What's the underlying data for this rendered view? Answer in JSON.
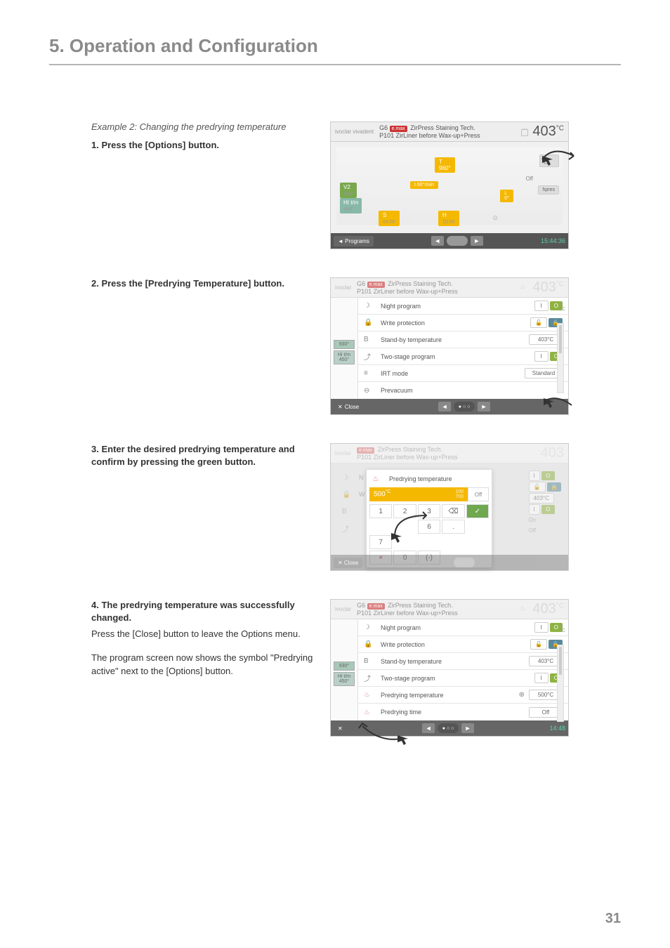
{
  "header": {
    "title": "5. Operation and Configuration"
  },
  "example_label": "Example 2: Changing the predrying temperature",
  "steps": {
    "s1": "1.  Press the [Options] button.",
    "s2": "2.  Press the [Predrying Temperature] button.",
    "s3": "3.  Enter the desired predrying temperature and confirm by pressing the green button.",
    "s4_title": "4.  The predrying temperature was successfully changed.",
    "s4_line1": "Press the [Close] button to leave the Options menu.",
    "s4_line2": "The program screen now shows the symbol \"Predrying active\" next to the [Options] button."
  },
  "shot1": {
    "brand": "ivoclar vivadent",
    "g": "G6",
    "chip": "e.max",
    "title1": "ZirPress Staining Tech.",
    "title2": "P101 ZirLiner before Wax-up+Press",
    "temp": "403",
    "temp_unit": "°C",
    "label_960": "960°",
    "label_s": "S",
    "label_s_val": "04:00",
    "label_h": "H",
    "label_h_val": "15:00",
    "off": "Off",
    "v2": "V2",
    "v2_val": "930°",
    "hi": "HI t/m",
    "hi_val": "450°",
    "t_top": "t",
    "t_top_val": "60°/min",
    "l_label": "L",
    "l_val": "0°",
    "footer_left": "◄ Programs",
    "time": "15:44:36"
  },
  "shot2": {
    "g": "G6",
    "title1": "ZirPress Staining Tech.",
    "title2": "P101 ZirLiner before Wax-up+Press",
    "temp": "403",
    "options": {
      "night": "Night program",
      "write": "Write protection",
      "standby": "Stand-by temperature",
      "twostage": "Two-stage program",
      "irt": "IRT mode",
      "prevac": "Prevacuum"
    },
    "vals": {
      "night_i": "I",
      "night_o": "O",
      "standby": "403°C",
      "two_i": "I",
      "two_o": "O",
      "irt": "Standard"
    },
    "close": "Close",
    "side_unit": "°C"
  },
  "shot3": {
    "temp": "403",
    "modal_title": "Predrying temperature",
    "val": "500",
    "val_unit": "°C",
    "off": "Off",
    "keys": {
      "k1": "1",
      "k2": "2",
      "k3": "3",
      "k6": "6",
      "k7": "7",
      "k0": "0",
      "kx": "×",
      "kdot": "."
    },
    "side": {
      "on": "On",
      "off": "Off"
    }
  },
  "shot4": {
    "g": "G6",
    "title1": "ZirPress Staining Tech.",
    "title2": "P101 ZirLiner before Wax-up+Press",
    "temp": "403",
    "options": {
      "night": "Night program",
      "write": "Write protection",
      "standby": "Stand-by temperature",
      "twostage": "Two-stage program",
      "pretemp": "Predrying temperature",
      "pretime": "Predrying time"
    },
    "vals": {
      "night_i": "I",
      "night_o": "O",
      "standby": "403°C",
      "two_i": "I",
      "two_o": "O",
      "pretemp": "500°C",
      "pretime": "Off"
    },
    "footer_time": "14:48"
  },
  "page_number": "31"
}
